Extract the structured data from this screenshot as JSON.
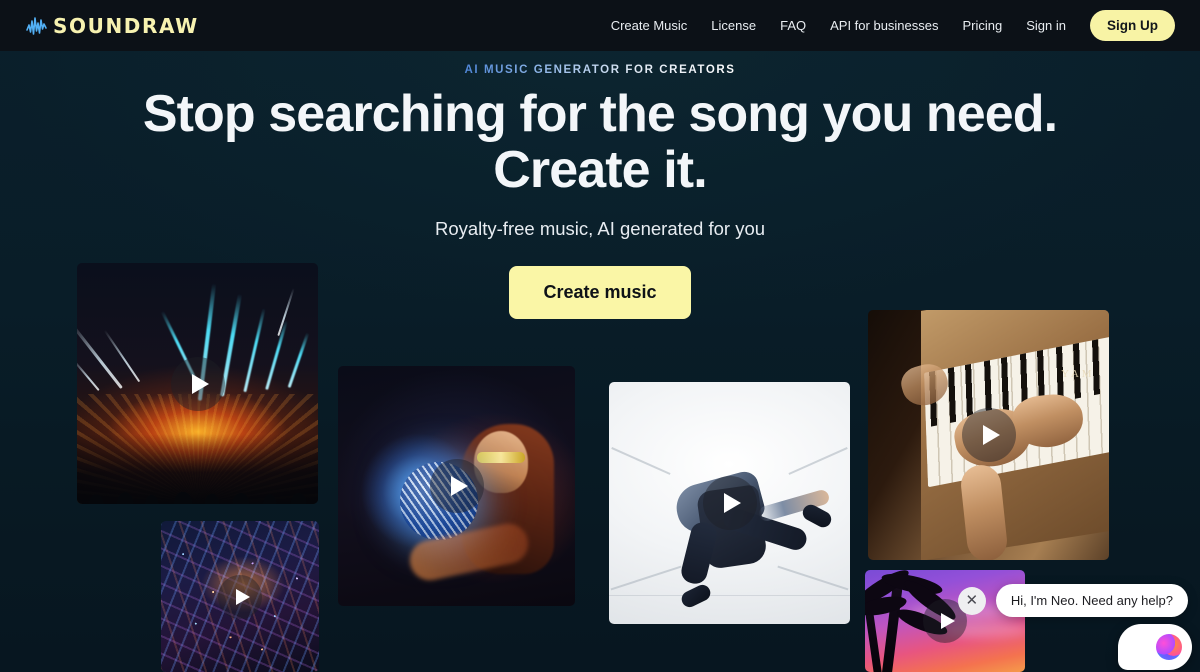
{
  "brand": {
    "name": "SOUNDRAW",
    "mark_icon": "waveform-icon",
    "mark_color": "#4aa8ff",
    "word_color": "#f7f2b0"
  },
  "nav": {
    "links": [
      {
        "label": "Create Music"
      },
      {
        "label": "License"
      },
      {
        "label": "FAQ"
      },
      {
        "label": "API for businesses"
      },
      {
        "label": "Pricing"
      },
      {
        "label": "Sign in"
      }
    ],
    "signup_label": "Sign Up",
    "signup_bg": "#f8f3a5",
    "bar_bg": "#0c1117"
  },
  "hero": {
    "eyebrow": "AI MUSIC GENERATOR FOR CREATORS",
    "headline_line1": "Stop searching for the song you need.",
    "headline_line2": "Create it.",
    "subtitle": "Royalty-free music, AI generated for you",
    "cta_label": "Create music",
    "cta_bg": "#faf6a6",
    "background": "#0a1f2b"
  },
  "cards": [
    {
      "name": "concert-lasers",
      "play_icon": "play-icon"
    },
    {
      "name": "night-city",
      "play_icon": "play-icon"
    },
    {
      "name": "disco-ball-woman",
      "play_icon": "play-icon"
    },
    {
      "name": "breakdancer-white-room",
      "play_icon": "play-icon"
    },
    {
      "name": "piano-hands",
      "play_icon": "play-icon",
      "brand_text": "YAM"
    },
    {
      "name": "tropical-sunset-palms",
      "play_icon": "play-icon"
    }
  ],
  "chat": {
    "message": "Hi, I'm Neo. Need any help?",
    "close_icon": "close-icon",
    "close_glyph": "✕",
    "avatar_icon": "neo-brain-icon"
  }
}
